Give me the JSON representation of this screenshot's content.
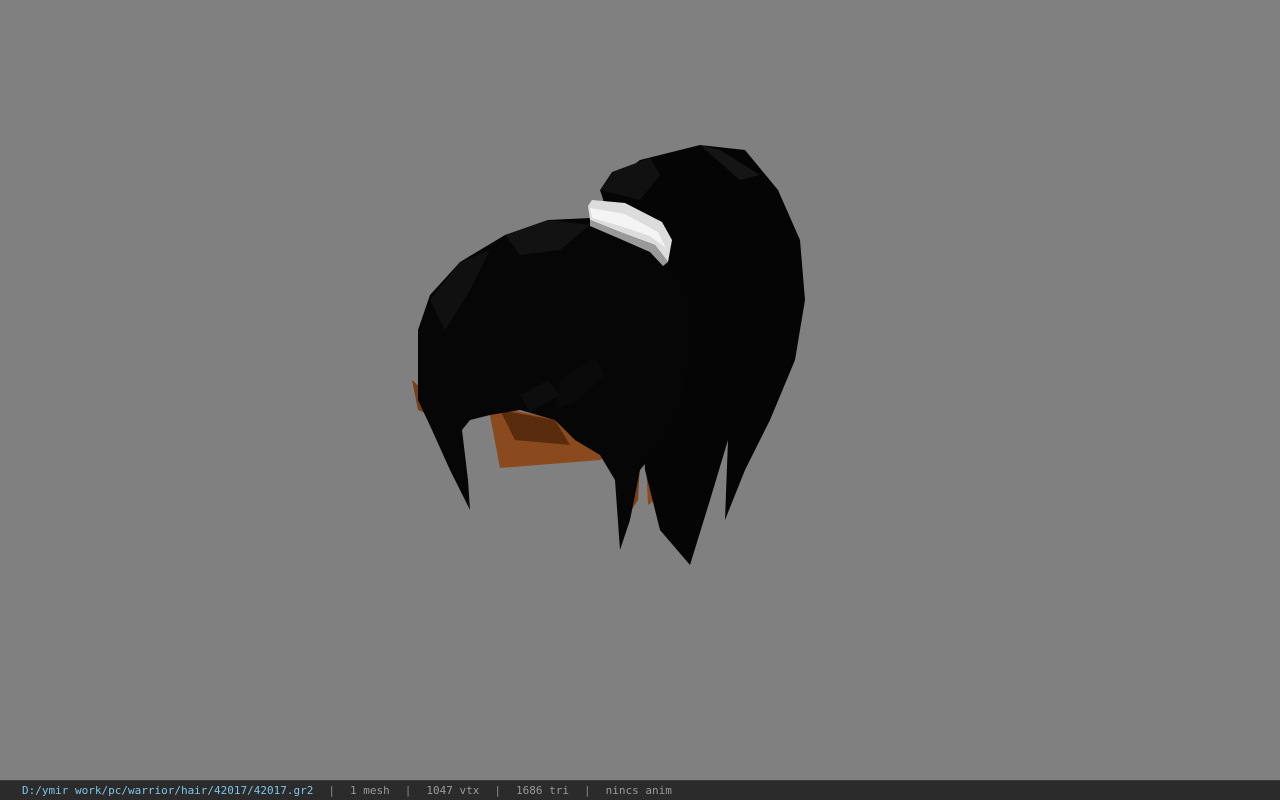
{
  "status_bar": {
    "file_path": "D:/ymir work/pc/warrior/hair/42017/42017.gr2",
    "separator": "|",
    "mesh_count": "1 mesh",
    "vertex_count": "1047 vtx",
    "triangle_count": "1686 tri",
    "anim_status": "nincs anim"
  },
  "viewport": {
    "background_color": "#808080",
    "model_subject": "hair-model",
    "hair_color": "#050505",
    "skin_color": "#8a4a1e",
    "band_color": "#e6e6e6"
  }
}
